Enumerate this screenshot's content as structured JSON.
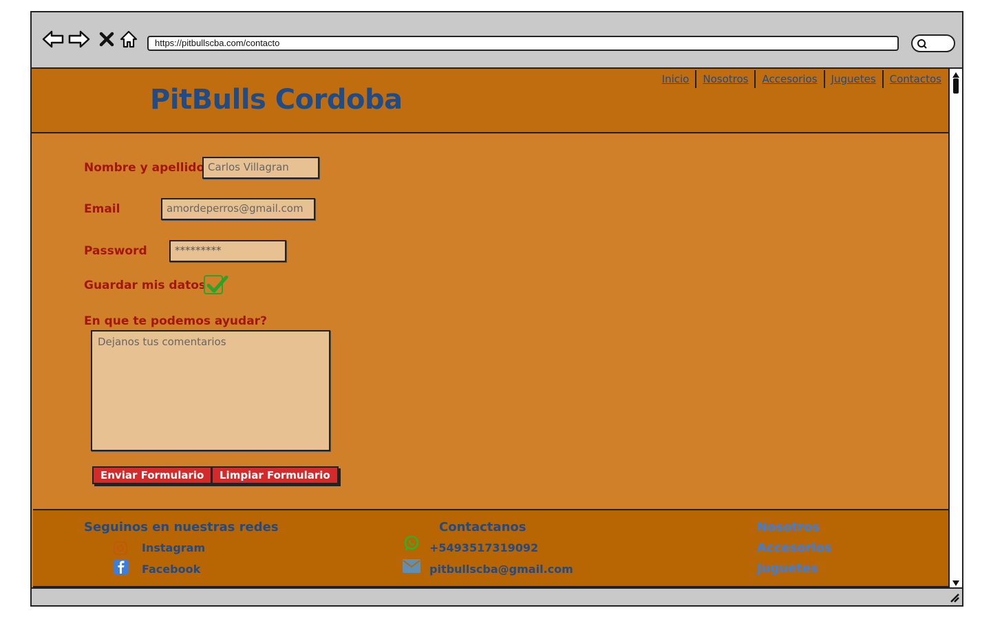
{
  "browser": {
    "url": "https://pitbullscba.com/contacto",
    "icons": [
      "back-arrow-icon",
      "forward-arrow-icon",
      "close-icon",
      "home-icon",
      "search-icon"
    ]
  },
  "header": {
    "title": "PitBulls Cordoba",
    "nav": [
      "Inicio",
      "Nosotros",
      "Accesorios",
      "Juguetes",
      "Contactos"
    ]
  },
  "form": {
    "name_label": "Nombre y apellido",
    "name_value": "Carlos Villagran",
    "email_label": "Email",
    "email_value": "amordeperros@gmail.com",
    "password_label": "Password",
    "password_value": "*********",
    "remember_label": "Guardar mis datos",
    "remember_checked": true,
    "help_label": "En que te podemos ayudar?",
    "comments_placeholder": "Dejanos tus comentarios",
    "submit_label": "Enviar Formulario",
    "clear_label": "Limpiar Formulario"
  },
  "footer": {
    "social_heading": "Seguinos en nuestras redes",
    "instagram": "Instagram",
    "facebook": "Facebook",
    "contact_heading": "Contactanos",
    "phone": "+5493517319092",
    "email": "pitbullscba@gmail.com",
    "links": [
      "Nosotros",
      "Accesorios",
      "Juguetes"
    ]
  },
  "colors": {
    "header_bg": "#c06d10",
    "page_bg": "#d08029",
    "footer_bg": "#b86504",
    "title": "#1f4b87",
    "label": "#a4160c",
    "button": "#d32b2b",
    "check": "#28a428"
  }
}
